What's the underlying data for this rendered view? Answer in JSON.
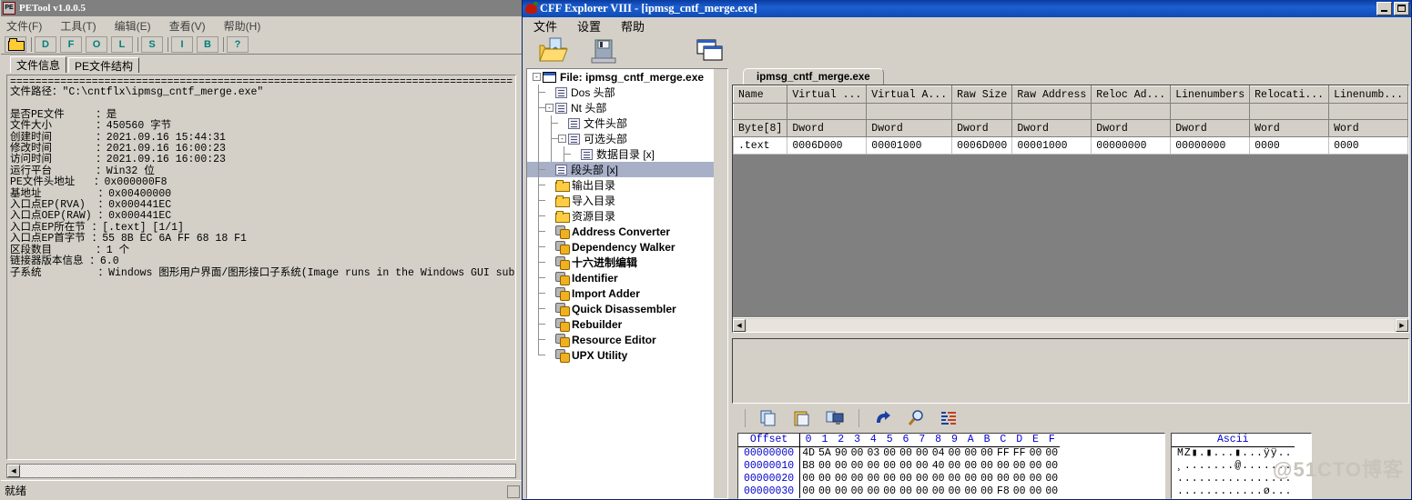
{
  "petool": {
    "title": "PETool v1.0.0.5",
    "app_icon": "PE",
    "menus": [
      "文件(F)",
      "工具(T)",
      "编辑(E)",
      "查看(V)",
      "帮助(H)"
    ],
    "toolbar_buttons": [
      "D",
      "F",
      "O",
      "L",
      "S",
      "I",
      "B",
      "?"
    ],
    "open_icon": "open-folder-icon",
    "tabs": [
      {
        "label": "文件信息",
        "selected": true
      },
      {
        "label": "PE文件结构",
        "selected": false
      }
    ],
    "info": {
      "divider": "================================================================================================",
      "file_path_line": "文件路径：\"C:\\cntflx\\ipmsg_cntf_merge.exe\"",
      "rows": [
        {
          "label": "是否PE文件",
          "value": "是"
        },
        {
          "label": "文件大小",
          "value": "450560 字节"
        },
        {
          "label": "创建时间",
          "value": "2021.09.16 15:44:31"
        },
        {
          "label": "修改时间",
          "value": "2021.09.16 16:00:23"
        },
        {
          "label": "访问时间",
          "value": "2021.09.16 16:00:23"
        },
        {
          "label": "运行平台",
          "value": "Win32 位"
        },
        {
          "label": "PE文件头地址",
          "value": "0x000000F8"
        },
        {
          "label": "基地址",
          "value": "0x00400000"
        },
        {
          "label": "入口点EP(RVA)",
          "value": "0x000441EC"
        },
        {
          "label": "入口点OEP(RAW)",
          "value": "0x000441EC"
        },
        {
          "label": "入口点EP所在节",
          "value": "[.text] [1/1]"
        },
        {
          "label": "入口点EP首字节",
          "value": "55 8B EC 6A FF 68 18 F1"
        },
        {
          "label": "区段数目",
          "value": "1 个"
        },
        {
          "label": "链接器版本信息",
          "value": "6.0"
        },
        {
          "label": "子系统",
          "value": "Windows 图形用户界面/图形接口子系统(Image runs in the Windows GUI subsystem.)"
        }
      ]
    },
    "status": "就绪"
  },
  "cff": {
    "title": "CFF Explorer VIII - [ipmsg_cntf_merge.exe]",
    "app_icon": "pepper-icon",
    "menus": [
      "文件",
      "设置",
      "帮助"
    ],
    "toolbar_icons": [
      "open-file-icon",
      "save-file-icon",
      "windows-icon"
    ],
    "window_buttons": [
      "minimize",
      "maximize",
      "close"
    ],
    "tree": [
      {
        "label": "File: ipmsg_cntf_merge.exe",
        "depth": 0,
        "icon": "window-icon",
        "expander": "-",
        "bold": true,
        "selected": false
      },
      {
        "label": "Dos 头部",
        "depth": 1,
        "icon": "doc-icon",
        "expander": "",
        "bold": false,
        "selected": false
      },
      {
        "label": "Nt 头部",
        "depth": 1,
        "icon": "doc-icon",
        "expander": "-",
        "bold": false,
        "selected": false
      },
      {
        "label": "文件头部",
        "depth": 2,
        "icon": "doc-icon",
        "expander": "",
        "bold": false,
        "selected": false
      },
      {
        "label": "可选头部",
        "depth": 2,
        "icon": "doc-icon",
        "expander": "-",
        "bold": false,
        "selected": false
      },
      {
        "label": "数据目录 [x]",
        "depth": 3,
        "icon": "doc-icon",
        "expander": "",
        "bold": false,
        "selected": false
      },
      {
        "label": "段头部 [x]",
        "depth": 1,
        "icon": "doc-icon",
        "expander": "",
        "bold": false,
        "selected": true
      },
      {
        "label": "输出目录",
        "depth": 1,
        "icon": "folder-icon",
        "expander": "",
        "bold": false,
        "selected": false
      },
      {
        "label": "导入目录",
        "depth": 1,
        "icon": "folder-icon",
        "expander": "",
        "bold": false,
        "selected": false
      },
      {
        "label": "资源目录",
        "depth": 1,
        "icon": "folder-icon",
        "expander": "",
        "bold": false,
        "selected": false
      },
      {
        "label": "Address Converter",
        "depth": 1,
        "icon": "tool-icon",
        "expander": "",
        "bold": true,
        "selected": false
      },
      {
        "label": "Dependency Walker",
        "depth": 1,
        "icon": "tool-icon",
        "expander": "",
        "bold": true,
        "selected": false
      },
      {
        "label": "十六进制编辑",
        "depth": 1,
        "icon": "tool-icon",
        "expander": "",
        "bold": true,
        "selected": false
      },
      {
        "label": "Identifier",
        "depth": 1,
        "icon": "tool-icon",
        "expander": "",
        "bold": true,
        "selected": false
      },
      {
        "label": "Import Adder",
        "depth": 1,
        "icon": "tool-icon",
        "expander": "",
        "bold": true,
        "selected": false
      },
      {
        "label": "Quick Disassembler",
        "depth": 1,
        "icon": "tool-icon",
        "expander": "",
        "bold": true,
        "selected": false
      },
      {
        "label": "Rebuilder",
        "depth": 1,
        "icon": "tool-icon",
        "expander": "",
        "bold": true,
        "selected": false
      },
      {
        "label": "Resource Editor",
        "depth": 1,
        "icon": "tool-icon",
        "expander": "",
        "bold": true,
        "selected": false
      },
      {
        "label": "UPX Utility",
        "depth": 1,
        "icon": "tool-icon",
        "expander": "",
        "bold": true,
        "selected": false
      }
    ],
    "tab": "ipmsg_cntf_merge.exe",
    "sections_table": {
      "headers": [
        "Name",
        "Virtual ...",
        "Virtual A...",
        "Raw Size",
        "Raw Address",
        "Reloc Ad...",
        "Linenumbers",
        "Relocati...",
        "Linenumb..."
      ],
      "types": [
        "Byte[8]",
        "Dword",
        "Dword",
        "Dword",
        "Dword",
        "Dword",
        "Dword",
        "Word",
        "Word"
      ],
      "rows": [
        [
          ".text",
          "0006D000",
          "00001000",
          "0006D000",
          "00001000",
          "00000000",
          "00000000",
          "0000",
          "0000"
        ]
      ]
    },
    "hex_toolbar_icons": [
      "copy-icon",
      "paste-icon",
      "copy-to-screen-icon",
      "redo-icon",
      "find-icon",
      "list-icon"
    ],
    "hex_view": {
      "offset_header": "Offset",
      "column_headers": [
        "0",
        "1",
        "2",
        "3",
        "4",
        "5",
        "6",
        "7",
        "8",
        "9",
        "A",
        "B",
        "C",
        "D",
        "E",
        "F"
      ],
      "ascii_header": "Ascii",
      "rows": [
        {
          "offset": "00000000",
          "bytes": [
            "4D",
            "5A",
            "90",
            "00",
            "03",
            "00",
            "00",
            "00",
            "04",
            "00",
            "00",
            "00",
            "FF",
            "FF",
            "00",
            "00"
          ],
          "ascii": "MZ▮.▮...▮...ÿÿ.."
        },
        {
          "offset": "00000010",
          "bytes": [
            "B8",
            "00",
            "00",
            "00",
            "00",
            "00",
            "00",
            "00",
            "40",
            "00",
            "00",
            "00",
            "00",
            "00",
            "00",
            "00"
          ],
          "ascii": "¸.......@......."
        },
        {
          "offset": "00000020",
          "bytes": [
            "00",
            "00",
            "00",
            "00",
            "00",
            "00",
            "00",
            "00",
            "00",
            "00",
            "00",
            "00",
            "00",
            "00",
            "00",
            "00"
          ],
          "ascii": "................"
        },
        {
          "offset": "00000030",
          "bytes": [
            "00",
            "00",
            "00",
            "00",
            "00",
            "00",
            "00",
            "00",
            "00",
            "00",
            "00",
            "00",
            "F8",
            "00",
            "00",
            "00"
          ],
          "ascii": "............ø..."
        }
      ]
    },
    "watermark": "@51CTO博客"
  },
  "colors": {
    "face": "#d4d0c8",
    "title_active": "#0a3ba0",
    "title_inactive": "#808080",
    "tree_selection": "#a8b0c8",
    "hex_blue": "#0000cc",
    "toolbar_teal": "#008080"
  }
}
